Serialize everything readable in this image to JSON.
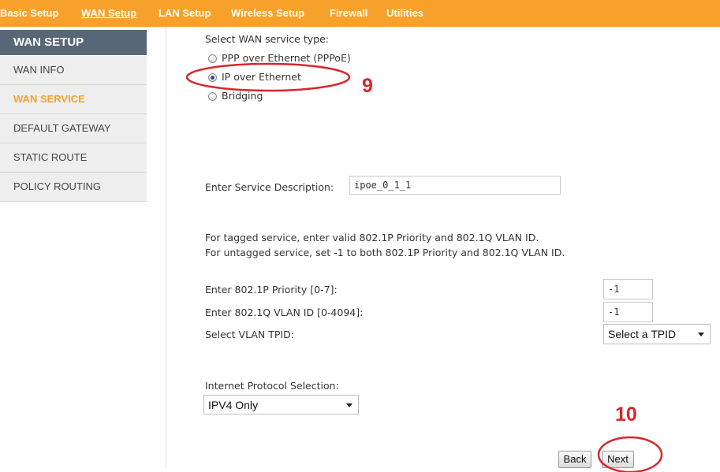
{
  "topnav": {
    "items": [
      {
        "label": "Basic Setup"
      },
      {
        "label": "WAN Setup"
      },
      {
        "label": "LAN Setup"
      },
      {
        "label": "Wireless Setup"
      },
      {
        "label": "Firewall"
      },
      {
        "label": "Utilities"
      }
    ],
    "active": "WAN Setup"
  },
  "sidebar": {
    "header": "WAN SETUP",
    "items": [
      {
        "label": "WAN INFO"
      },
      {
        "label": "WAN SERVICE"
      },
      {
        "label": "DEFAULT GATEWAY"
      },
      {
        "label": "STATIC ROUTE"
      },
      {
        "label": "POLICY ROUTING"
      }
    ],
    "active": "WAN SERVICE"
  },
  "main": {
    "service_type_label": "Select WAN service type:",
    "service_options": [
      {
        "label": "PPP over Ethernet (PPPoE)",
        "checked": false
      },
      {
        "label": "IP over Ethernet",
        "checked": true
      },
      {
        "label": "Bridging",
        "checked": false
      }
    ],
    "description_label": "Enter Service Description:",
    "description_value": "ipoe_0_1_1",
    "tagged_note": "For tagged service, enter valid 802.1P Priority and 802.1Q VLAN ID.",
    "untagged_note": "For untagged service, set -1 to both 802.1P Priority and 802.1Q VLAN ID.",
    "priority_label": "Enter 802.1P Priority [0-7]:",
    "priority_value": "-1",
    "vlan_label": "Enter 802.1Q VLAN ID [0-4094]:",
    "vlan_value": "-1",
    "tpid_label": "Select VLAN TPID:",
    "tpid_value": "Select a TPID",
    "protocol_label": "Internet Protocol Selection:",
    "protocol_value": "IPV4 Only",
    "back_label": "Back",
    "next_label": "Next"
  },
  "annotations": {
    "step9": "9",
    "step10": "10",
    "color": "#d9262a"
  },
  "colors": {
    "accent": "#f7a12b",
    "sidebar_header_bg": "#596675",
    "sidebar_item_bg": "#eeeeee"
  }
}
